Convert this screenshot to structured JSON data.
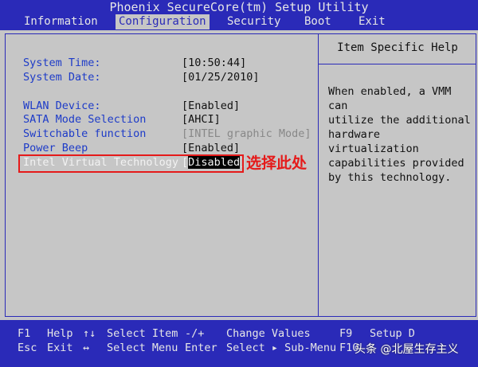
{
  "title": "Phoenix SecureCore(tm) Setup Utility",
  "menu": {
    "information": "Information",
    "configuration": "Configuration",
    "security": "Security",
    "boot": "Boot",
    "exit": "Exit"
  },
  "settings": [
    {
      "label": "System Time:",
      "value": "[10:50:44]"
    },
    {
      "label": "System Date:",
      "value": "[01/25/2010]"
    },
    {
      "label": "WLAN Device:",
      "value": "[Enabled]"
    },
    {
      "label": "SATA Mode Selection",
      "value": "[AHCI]"
    },
    {
      "label": "Switchable function",
      "value": "[INTEL graphic Mode]"
    },
    {
      "label": "Power Beep",
      "value": "[Enabled]"
    },
    {
      "label": "Intel Virtual Technology",
      "value": "Disabled"
    }
  ],
  "help": {
    "title": "Item Specific Help",
    "text": "When enabled, a VMM can\nutilize the additional\nhardware virtualization\ncapabilities provided\nby this technology."
  },
  "annotation": "选择此处",
  "footer": {
    "f1": "F1",
    "help": "Help",
    "esc": "Esc",
    "exit": "Exit",
    "updown": "↑↓",
    "select_item": "Select Item",
    "leftright": "↔",
    "select_menu": "Select Menu",
    "minus_plus": "-/+",
    "change_values": "Change Values",
    "enter": "Enter",
    "select_submenu": "Select ▸ Sub-Menu",
    "f9": "F9",
    "f9_label": "Setup D",
    "f10": "F10"
  },
  "watermark": "头条 @北屋生存主义",
  "colors": {
    "bios_blue": "#2a2ab8",
    "bios_gray": "#c6c6c6",
    "label_blue": "#1d3bc8",
    "annotation_red": "#e51a1a"
  }
}
